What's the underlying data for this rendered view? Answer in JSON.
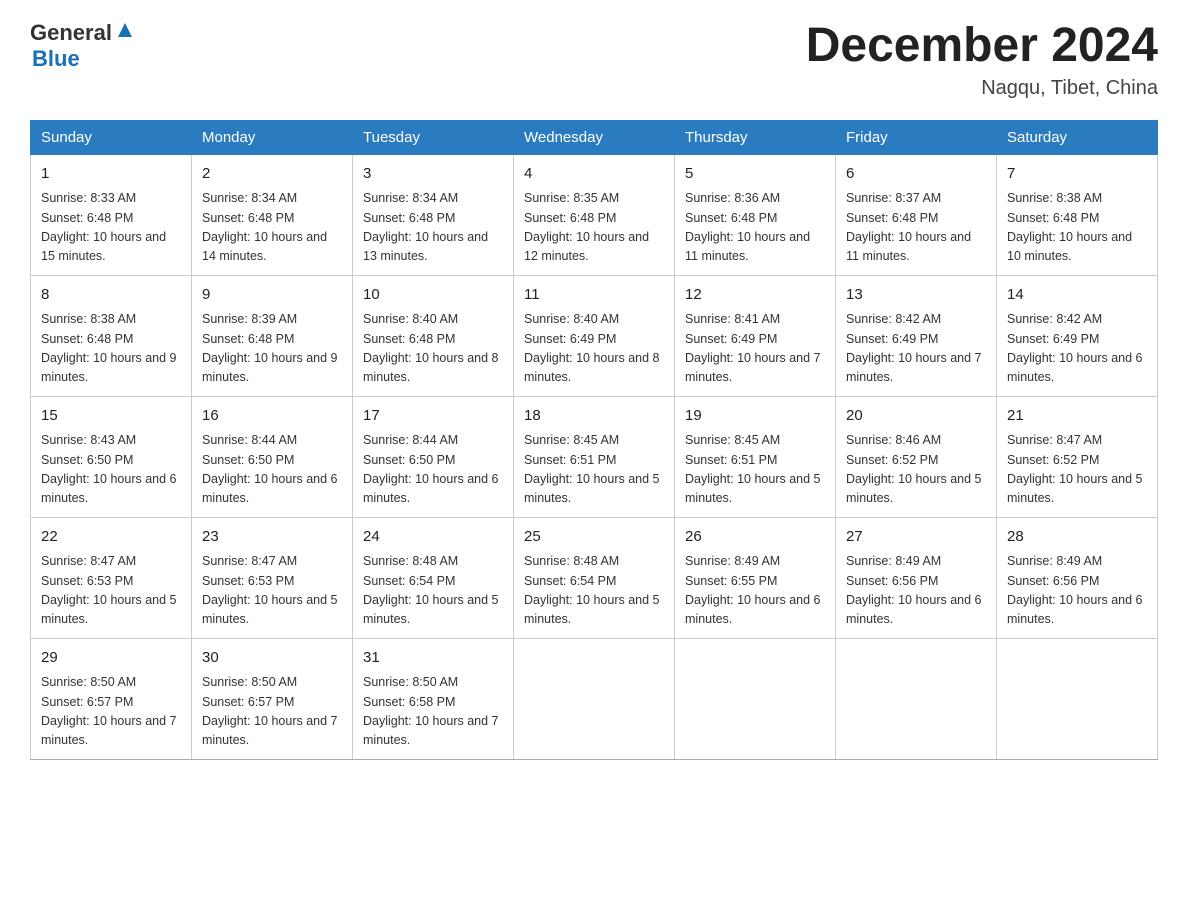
{
  "header": {
    "logo_general": "General",
    "logo_blue": "Blue",
    "month_title": "December 2024",
    "location": "Nagqu, Tibet, China"
  },
  "days_of_week": [
    "Sunday",
    "Monday",
    "Tuesday",
    "Wednesday",
    "Thursday",
    "Friday",
    "Saturday"
  ],
  "weeks": [
    [
      {
        "day": "1",
        "sunrise": "8:33 AM",
        "sunset": "6:48 PM",
        "daylight": "10 hours and 15 minutes."
      },
      {
        "day": "2",
        "sunrise": "8:34 AM",
        "sunset": "6:48 PM",
        "daylight": "10 hours and 14 minutes."
      },
      {
        "day": "3",
        "sunrise": "8:34 AM",
        "sunset": "6:48 PM",
        "daylight": "10 hours and 13 minutes."
      },
      {
        "day": "4",
        "sunrise": "8:35 AM",
        "sunset": "6:48 PM",
        "daylight": "10 hours and 12 minutes."
      },
      {
        "day": "5",
        "sunrise": "8:36 AM",
        "sunset": "6:48 PM",
        "daylight": "10 hours and 11 minutes."
      },
      {
        "day": "6",
        "sunrise": "8:37 AM",
        "sunset": "6:48 PM",
        "daylight": "10 hours and 11 minutes."
      },
      {
        "day": "7",
        "sunrise": "8:38 AM",
        "sunset": "6:48 PM",
        "daylight": "10 hours and 10 minutes."
      }
    ],
    [
      {
        "day": "8",
        "sunrise": "8:38 AM",
        "sunset": "6:48 PM",
        "daylight": "10 hours and 9 minutes."
      },
      {
        "day": "9",
        "sunrise": "8:39 AM",
        "sunset": "6:48 PM",
        "daylight": "10 hours and 9 minutes."
      },
      {
        "day": "10",
        "sunrise": "8:40 AM",
        "sunset": "6:48 PM",
        "daylight": "10 hours and 8 minutes."
      },
      {
        "day": "11",
        "sunrise": "8:40 AM",
        "sunset": "6:49 PM",
        "daylight": "10 hours and 8 minutes."
      },
      {
        "day": "12",
        "sunrise": "8:41 AM",
        "sunset": "6:49 PM",
        "daylight": "10 hours and 7 minutes."
      },
      {
        "day": "13",
        "sunrise": "8:42 AM",
        "sunset": "6:49 PM",
        "daylight": "10 hours and 7 minutes."
      },
      {
        "day": "14",
        "sunrise": "8:42 AM",
        "sunset": "6:49 PM",
        "daylight": "10 hours and 6 minutes."
      }
    ],
    [
      {
        "day": "15",
        "sunrise": "8:43 AM",
        "sunset": "6:50 PM",
        "daylight": "10 hours and 6 minutes."
      },
      {
        "day": "16",
        "sunrise": "8:44 AM",
        "sunset": "6:50 PM",
        "daylight": "10 hours and 6 minutes."
      },
      {
        "day": "17",
        "sunrise": "8:44 AM",
        "sunset": "6:50 PM",
        "daylight": "10 hours and 6 minutes."
      },
      {
        "day": "18",
        "sunrise": "8:45 AM",
        "sunset": "6:51 PM",
        "daylight": "10 hours and 5 minutes."
      },
      {
        "day": "19",
        "sunrise": "8:45 AM",
        "sunset": "6:51 PM",
        "daylight": "10 hours and 5 minutes."
      },
      {
        "day": "20",
        "sunrise": "8:46 AM",
        "sunset": "6:52 PM",
        "daylight": "10 hours and 5 minutes."
      },
      {
        "day": "21",
        "sunrise": "8:47 AM",
        "sunset": "6:52 PM",
        "daylight": "10 hours and 5 minutes."
      }
    ],
    [
      {
        "day": "22",
        "sunrise": "8:47 AM",
        "sunset": "6:53 PM",
        "daylight": "10 hours and 5 minutes."
      },
      {
        "day": "23",
        "sunrise": "8:47 AM",
        "sunset": "6:53 PM",
        "daylight": "10 hours and 5 minutes."
      },
      {
        "day": "24",
        "sunrise": "8:48 AM",
        "sunset": "6:54 PM",
        "daylight": "10 hours and 5 minutes."
      },
      {
        "day": "25",
        "sunrise": "8:48 AM",
        "sunset": "6:54 PM",
        "daylight": "10 hours and 5 minutes."
      },
      {
        "day": "26",
        "sunrise": "8:49 AM",
        "sunset": "6:55 PM",
        "daylight": "10 hours and 6 minutes."
      },
      {
        "day": "27",
        "sunrise": "8:49 AM",
        "sunset": "6:56 PM",
        "daylight": "10 hours and 6 minutes."
      },
      {
        "day": "28",
        "sunrise": "8:49 AM",
        "sunset": "6:56 PM",
        "daylight": "10 hours and 6 minutes."
      }
    ],
    [
      {
        "day": "29",
        "sunrise": "8:50 AM",
        "sunset": "6:57 PM",
        "daylight": "10 hours and 7 minutes."
      },
      {
        "day": "30",
        "sunrise": "8:50 AM",
        "sunset": "6:57 PM",
        "daylight": "10 hours and 7 minutes."
      },
      {
        "day": "31",
        "sunrise": "8:50 AM",
        "sunset": "6:58 PM",
        "daylight": "10 hours and 7 minutes."
      },
      null,
      null,
      null,
      null
    ]
  ]
}
